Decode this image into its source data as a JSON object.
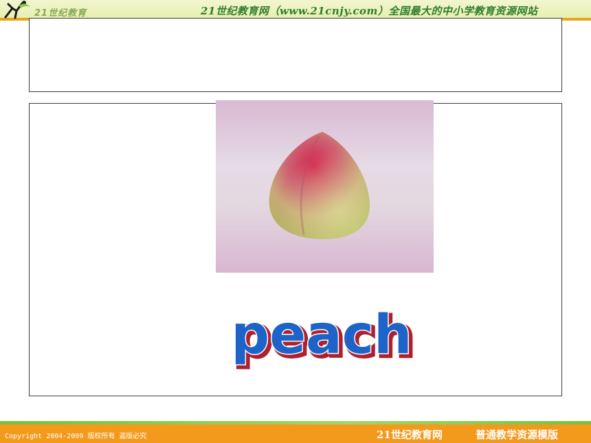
{
  "header": {
    "logo_text": "21世纪教育",
    "slogan": "21世纪教育网（www.21cnjy.com）全国最大的中小学教育资源网站"
  },
  "main": {
    "word": "peach",
    "word_color": "#1e63c8",
    "word_shadow_color": "#b0202c"
  },
  "footer": {
    "copyright": "Copyright 2004-2009 版权所有 盗版必究",
    "site_name": "21世纪教育网",
    "tagline": "普通教学资源模版"
  },
  "colors": {
    "header_green": "#2f7e2f",
    "footer_orange": "#f39a1c",
    "footer_green": "#7bbf3a"
  }
}
